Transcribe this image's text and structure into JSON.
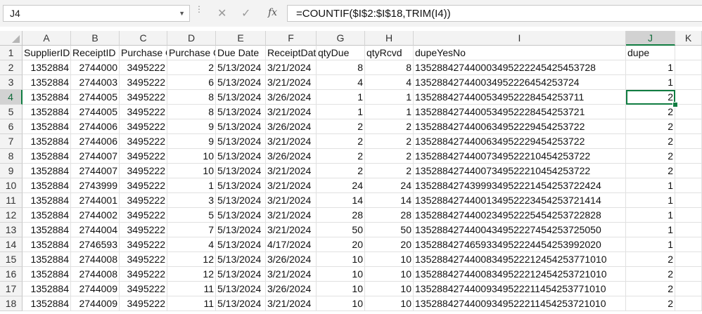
{
  "formula_bar": {
    "name_box": "J4",
    "formula": "=COUNTIF($I$2:$I$18,TRIM(I4))",
    "fx_label": "fx"
  },
  "columns": [
    "A",
    "B",
    "C",
    "D",
    "E",
    "F",
    "G",
    "H",
    "I",
    "J",
    "K"
  ],
  "row_numbers": [
    "1",
    "2",
    "3",
    "4",
    "5",
    "6",
    "7",
    "8",
    "9",
    "10",
    "11",
    "12",
    "13",
    "14",
    "15",
    "16",
    "17",
    "18"
  ],
  "headers": [
    "SupplierID",
    "ReceiptID",
    "Purchase O",
    "Purchase O",
    "Due Date",
    "ReceiptDat",
    "qtyDue",
    "qtyRcvd",
    "dupeYesNo",
    "dupe",
    ""
  ],
  "rows": [
    [
      "1352884",
      "2744000",
      "3495222",
      "2",
      "5/13/2024",
      "3/21/2024",
      "8",
      "8",
      "135288427440003495222245425453728",
      "1"
    ],
    [
      "1352884",
      "2744003",
      "3495222",
      "6",
      "5/13/2024",
      "3/21/2024",
      "4",
      "4",
      "135288427440034952226454253724",
      "1"
    ],
    [
      "1352884",
      "2744005",
      "3495222",
      "8",
      "5/13/2024",
      "3/26/2024",
      "1",
      "1",
      "1352884274400534952228454253711",
      "2"
    ],
    [
      "1352884",
      "2744005",
      "3495222",
      "8",
      "5/13/2024",
      "3/21/2024",
      "1",
      "1",
      "1352884274400534952228454253721",
      "2"
    ],
    [
      "1352884",
      "2744006",
      "3495222",
      "9",
      "5/13/2024",
      "3/26/2024",
      "2",
      "2",
      "1352884274400634952229454253722",
      "2"
    ],
    [
      "1352884",
      "2744006",
      "3495222",
      "9",
      "5/13/2024",
      "3/21/2024",
      "2",
      "2",
      "1352884274400634952229454253722",
      "2"
    ],
    [
      "1352884",
      "2744007",
      "3495222",
      "10",
      "5/13/2024",
      "3/26/2024",
      "2",
      "2",
      "13528842744007349522210454253722",
      "2"
    ],
    [
      "1352884",
      "2744007",
      "3495222",
      "10",
      "5/13/2024",
      "3/21/2024",
      "2",
      "2",
      "13528842744007349522210454253722",
      "2"
    ],
    [
      "1352884",
      "2743999",
      "3495222",
      "1",
      "5/13/2024",
      "3/21/2024",
      "24",
      "24",
      "1352884274399934952221454253722424",
      "1"
    ],
    [
      "1352884",
      "2744001",
      "3495222",
      "3",
      "5/13/2024",
      "3/21/2024",
      "14",
      "14",
      "1352884274400134952223454253721414",
      "1"
    ],
    [
      "1352884",
      "2744002",
      "3495222",
      "5",
      "5/13/2024",
      "3/21/2024",
      "28",
      "28",
      "1352884274400234952225454253722828",
      "1"
    ],
    [
      "1352884",
      "2744004",
      "3495222",
      "7",
      "5/13/2024",
      "3/21/2024",
      "50",
      "50",
      "1352884274400434952227454253725050",
      "1"
    ],
    [
      "1352884",
      "2746593",
      "3495222",
      "4",
      "5/13/2024",
      "4/17/2024",
      "20",
      "20",
      "1352884274659334952224454253992020",
      "1"
    ],
    [
      "1352884",
      "2744008",
      "3495222",
      "12",
      "5/13/2024",
      "3/26/2024",
      "10",
      "10",
      "13528842744008349522212454253771010",
      "2"
    ],
    [
      "1352884",
      "2744008",
      "3495222",
      "12",
      "5/13/2024",
      "3/21/2024",
      "10",
      "10",
      "13528842744008349522212454253721010",
      "2"
    ],
    [
      "1352884",
      "2744009",
      "3495222",
      "11",
      "5/13/2024",
      "3/26/2024",
      "10",
      "10",
      "13528842744009349522211454253771010",
      "2"
    ],
    [
      "1352884",
      "2744009",
      "3495222",
      "11",
      "5/13/2024",
      "3/21/2024",
      "10",
      "10",
      "13528842744009349522211454253721010",
      "2"
    ]
  ],
  "column_types": [
    "num",
    "num",
    "num",
    "num",
    "txt",
    "txt",
    "num",
    "num",
    "txt",
    "num",
    "txt"
  ],
  "selected_cell": {
    "col": "J",
    "row": "4"
  },
  "colors": {
    "accent": "#107c41",
    "header_bg": "#f3f3f3",
    "grid_line": "#e1e1e1"
  }
}
